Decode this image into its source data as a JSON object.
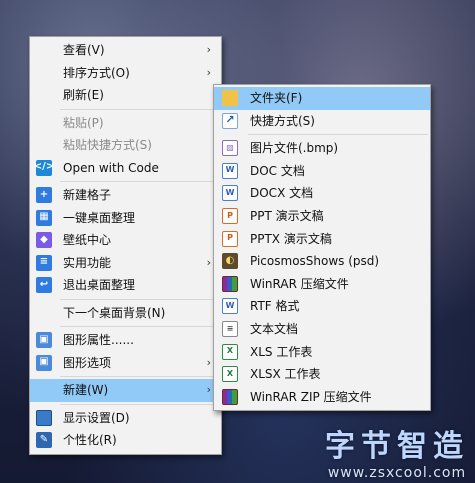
{
  "context_menu": {
    "items": [
      {
        "label": "查看(V)",
        "submenu": true
      },
      {
        "label": "排序方式(O)",
        "submenu": true
      },
      {
        "label": "刷新(E)"
      },
      {
        "label": "粘贴(P)",
        "disabled": true
      },
      {
        "label": "粘贴快捷方式(S)",
        "disabled": true
      },
      {
        "label": "Open with Code",
        "icon": "vscode-icon"
      },
      {
        "label": "新建格子",
        "icon": "plus-grid-icon"
      },
      {
        "label": "一键桌面整理",
        "icon": "layout-icon"
      },
      {
        "label": "壁纸中心",
        "icon": "cube-icon"
      },
      {
        "label": "实用功能",
        "icon": "list-icon",
        "submenu": true
      },
      {
        "label": "退出桌面整理",
        "icon": "exit-icon"
      },
      {
        "label": "下一个桌面背景(N)"
      },
      {
        "label": "图形属性......",
        "icon": "graphics-properties-icon"
      },
      {
        "label": "图形选项",
        "icon": "graphics-options-icon",
        "submenu": true
      },
      {
        "label": "新建(W)",
        "submenu": true,
        "active": true
      },
      {
        "label": "显示设置(D)",
        "icon": "display-icon"
      },
      {
        "label": "个性化(R)",
        "icon": "personalize-icon"
      }
    ]
  },
  "new_submenu": {
    "items": [
      {
        "label": "文件夹(F)",
        "icon": "folder-icon",
        "active": true
      },
      {
        "label": "快捷方式(S)",
        "icon": "shortcut-icon"
      },
      {
        "label": "图片文件(.bmp)",
        "icon": "bmp-file-icon"
      },
      {
        "label": "DOC 文档",
        "icon": "doc-file-icon"
      },
      {
        "label": "DOCX 文档",
        "icon": "docx-file-icon"
      },
      {
        "label": "PPT 演示文稿",
        "icon": "ppt-file-icon"
      },
      {
        "label": "PPTX 演示文稿",
        "icon": "pptx-file-icon"
      },
      {
        "label": "PicosmosShows (psd)",
        "icon": "psd-file-icon"
      },
      {
        "label": "WinRAR 压缩文件",
        "icon": "winrar-icon"
      },
      {
        "label": "RTF 格式",
        "icon": "rtf-file-icon"
      },
      {
        "label": "文本文档",
        "icon": "txt-file-icon"
      },
      {
        "label": "XLS 工作表",
        "icon": "xls-file-icon"
      },
      {
        "label": "XLSX 工作表",
        "icon": "xlsx-file-icon"
      },
      {
        "label": "WinRAR ZIP 压缩文件",
        "icon": "winrar-zip-icon"
      }
    ]
  },
  "watermark": {
    "title": "字节智造",
    "url": "www.zsxcool.com"
  },
  "colors": {
    "highlight": "#91c9f7",
    "menu_bg": "#f2f2f2",
    "disabled_text": "#8a8a8a"
  }
}
